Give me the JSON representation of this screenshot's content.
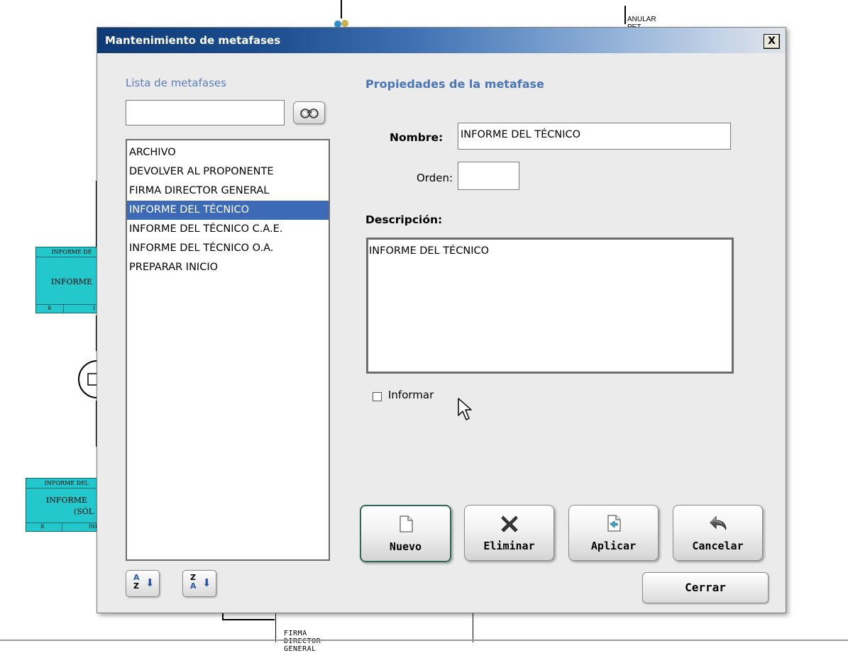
{
  "background": {
    "top_label": "ANULAR PET.",
    "bottom_label": "FIRMA DIRECTOR GENERAL",
    "box1": {
      "header": "INFORME DE",
      "middle": "INFORME",
      "footer_left": "R",
      "footer_right": "I"
    },
    "box2": {
      "header": "INFORME DEL",
      "middle_line1": "INFORME",
      "middle_line2": "(SÓL",
      "footer_left": "R",
      "footer_right": "INF"
    }
  },
  "dialog": {
    "title": "Mantenimiento de metafases",
    "close_label": "X",
    "list_title": "Lista de metafases",
    "search_value": "",
    "list_items": [
      "ARCHIVO",
      "DEVOLVER AL PROPONENTE",
      "FIRMA DIRECTOR GENERAL",
      "INFORME DEL TÉCNICO",
      "INFORME DEL TÉCNICO C.A.E.",
      "INFORME DEL TÉCNICO O.A.",
      "PREPARAR INICIO"
    ],
    "selected_index": 3,
    "sort_asc": {
      "top": "A",
      "bottom": "Z"
    },
    "sort_desc": {
      "top": "Z",
      "bottom": "A"
    },
    "properties_title": "Propiedades de la metafase",
    "nombre_label": "Nombre:",
    "nombre_value": "INFORME DEL TÉCNICO",
    "orden_label": "Orden:",
    "orden_value": "",
    "descripcion_label": "Descripción:",
    "descripcion_value": "INFORME DEL TÉCNICO",
    "informar_label": "Informar",
    "informar_checked": false,
    "buttons": {
      "nuevo": "Nuevo",
      "eliminar": "Eliminar",
      "aplicar": "Aplicar",
      "cancelar": "Cancelar",
      "cerrar": "Cerrar"
    },
    "colors": {
      "title_start": "#0e3a75",
      "accent": "#4a75b6",
      "selection": "#3d6ab7",
      "box_fill": "#22c8cc"
    }
  }
}
